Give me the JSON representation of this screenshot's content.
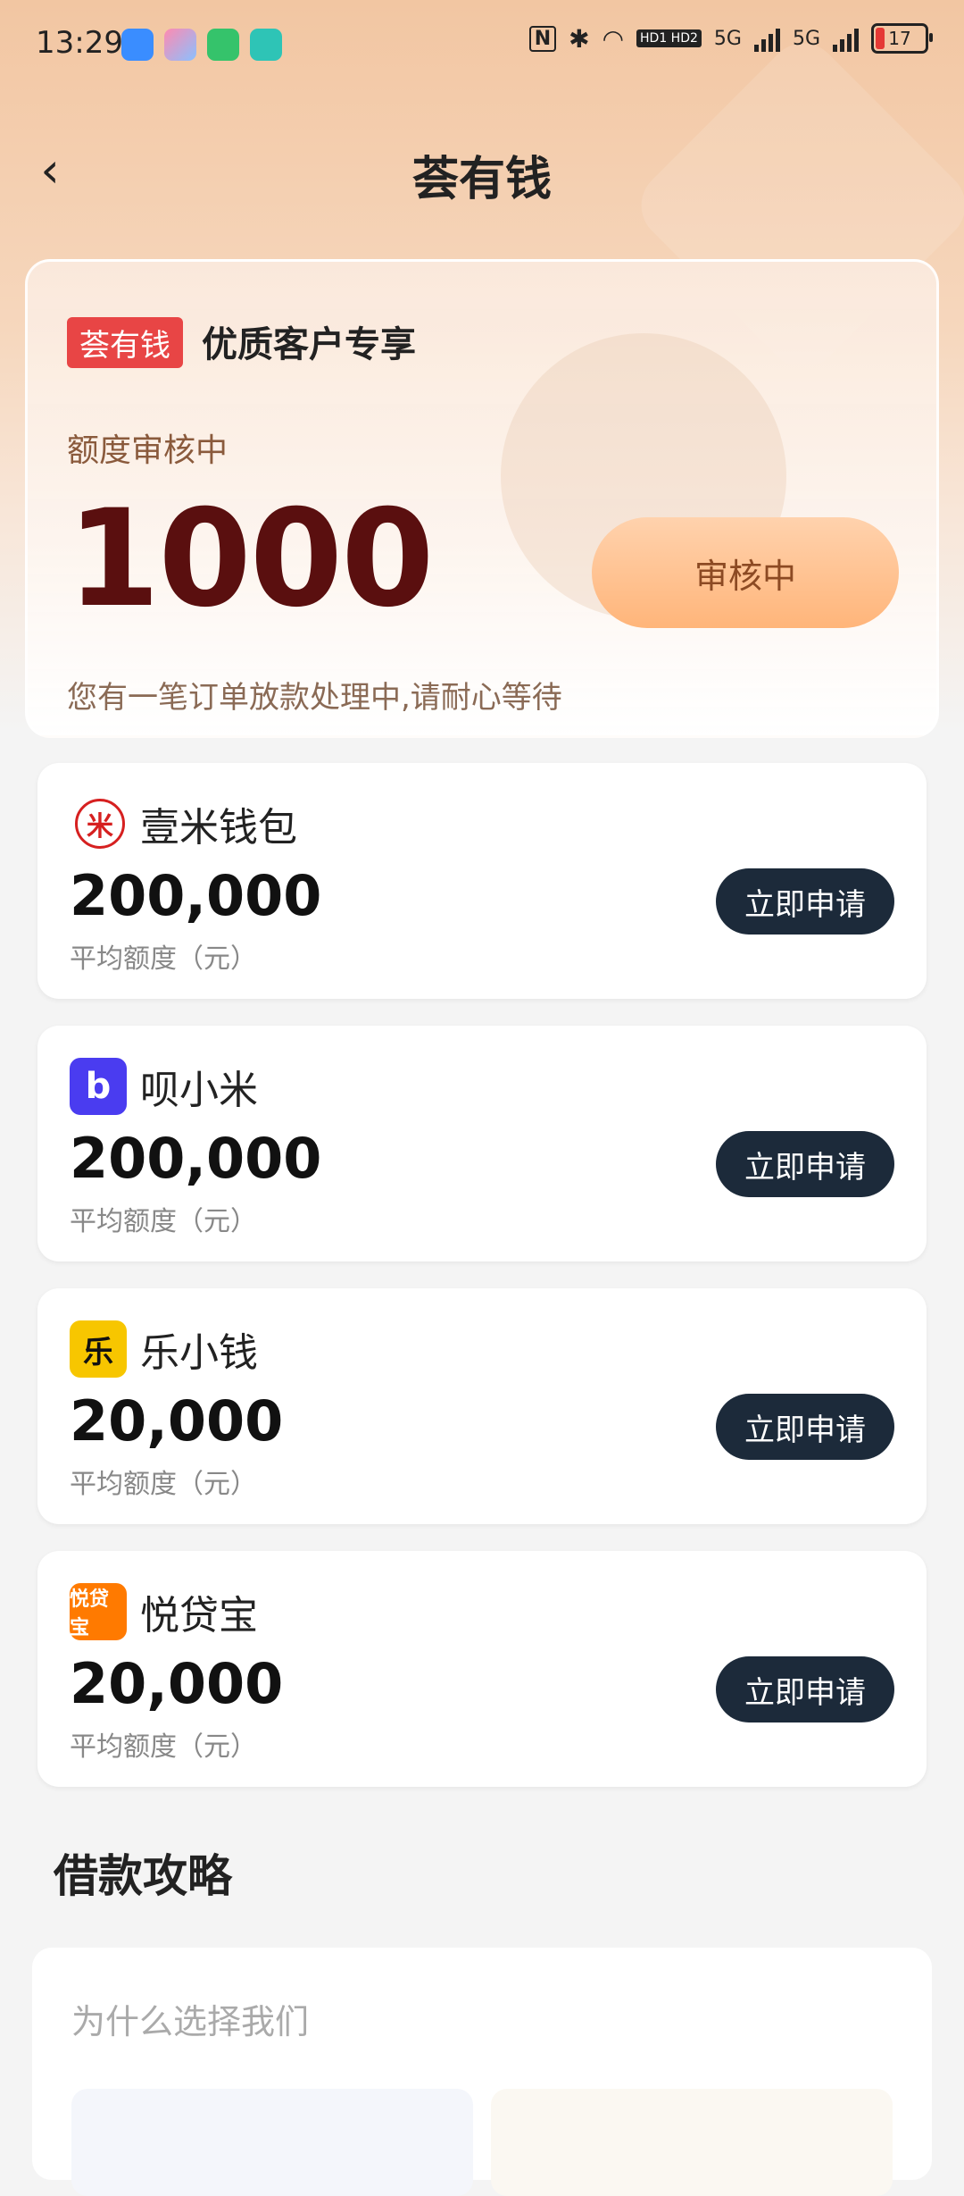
{
  "status_bar": {
    "time": "13:29",
    "network_1": "5G",
    "network_2": "5G",
    "hd_label": "HD1 HD2",
    "battery": "17",
    "battery_color": "#e53935"
  },
  "nav": {
    "title": "荟有钱",
    "back_icon": "chevron-left-icon"
  },
  "hero": {
    "brand_tag": "荟有钱",
    "subtitle": "优质客户专享",
    "limit_label": "额度审核中",
    "amount": "1000",
    "status_button": "审核中",
    "note": "您有一笔订单放款处理中,请耐心等待",
    "brand_color": "#e84545",
    "amount_color": "#5a0f0f"
  },
  "products": [
    {
      "name": "壹米钱包",
      "amount": "200,000",
      "label": "平均额度（元）",
      "button": "立即申请",
      "logo_color": "#d62020",
      "logo_icon": "mi-wallet-icon"
    },
    {
      "name": "呗小米",
      "amount": "200,000",
      "label": "平均额度（元）",
      "button": "立即申请",
      "logo_color": "#4a3cf0",
      "logo_icon": "bei-xiaomi-icon"
    },
    {
      "name": "乐小钱",
      "amount": "20,000",
      "label": "平均额度（元）",
      "button": "立即申请",
      "logo_color": "#f7c600",
      "logo_icon": "le-xiaoqian-icon"
    },
    {
      "name": "悦贷宝",
      "amount": "20,000",
      "label": "平均额度（元）",
      "button": "立即申请",
      "logo_color": "#ff7a00",
      "logo_icon": "yue-daibao-icon"
    }
  ],
  "guide": {
    "title": "借款攻略",
    "subtitle": "为什么选择我们"
  }
}
